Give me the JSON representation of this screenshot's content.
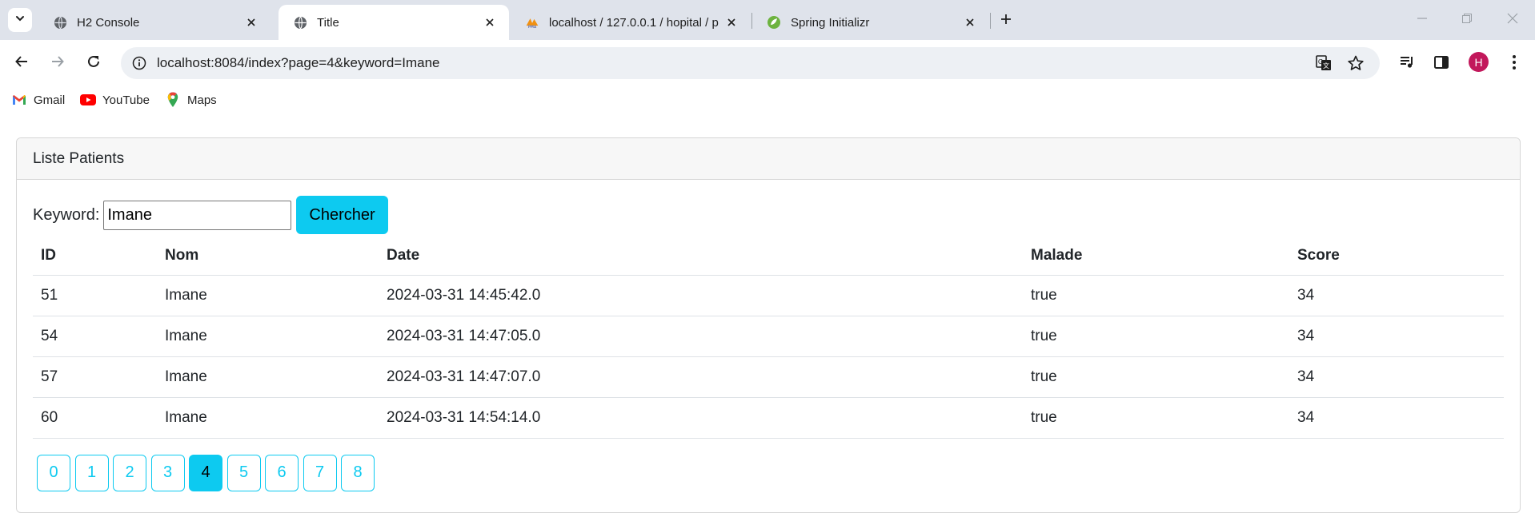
{
  "browser": {
    "tabs": [
      {
        "label": "H2 Console",
        "icon": "globe-icon",
        "active": false
      },
      {
        "label": "Title",
        "icon": "globe-icon",
        "active": true
      },
      {
        "label": "localhost / 127.0.0.1 / hopital / p",
        "icon": "phpmyadmin-icon",
        "active": false
      },
      {
        "label": "Spring Initializr",
        "icon": "spring-icon",
        "active": false
      }
    ],
    "url": "localhost:8084/index?page=4&keyword=Imane",
    "profile_initial": "H",
    "profile_color": "#c2185b",
    "bookmarks": [
      {
        "label": "Gmail",
        "icon": "gmail-icon"
      },
      {
        "label": "YouTube",
        "icon": "youtube-icon"
      },
      {
        "label": "Maps",
        "icon": "maps-icon"
      }
    ]
  },
  "page": {
    "card_title": "Liste Patients",
    "search": {
      "label": "Keyword:",
      "value": "Imane",
      "button_label": "Chercher"
    },
    "table": {
      "headers": [
        "ID",
        "Nom",
        "Date",
        "Malade",
        "Score"
      ],
      "rows": [
        [
          "51",
          "Imane",
          "2024-03-31 14:45:42.0",
          "true",
          "34"
        ],
        [
          "54",
          "Imane",
          "2024-03-31 14:47:05.0",
          "true",
          "34"
        ],
        [
          "57",
          "Imane",
          "2024-03-31 14:47:07.0",
          "true",
          "34"
        ],
        [
          "60",
          "Imane",
          "2024-03-31 14:54:14.0",
          "true",
          "34"
        ]
      ]
    },
    "pagination": {
      "pages": [
        "0",
        "1",
        "2",
        "3",
        "4",
        "5",
        "6",
        "7",
        "8"
      ],
      "current": "4"
    },
    "accent_color": "#0dcaf0"
  }
}
